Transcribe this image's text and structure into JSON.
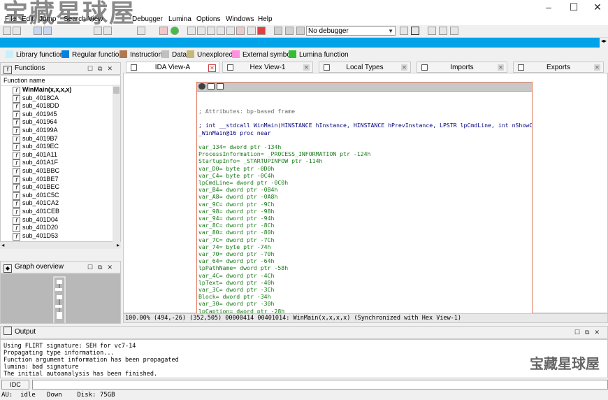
{
  "watermark": {
    "top": "宝藏星球屋",
    "bottom": "宝藏星球屋"
  },
  "menu": [
    "File",
    "Edit",
    "Jump",
    "Search",
    "View",
    "Debugger",
    "Lumina",
    "Options",
    "Windows",
    "Help"
  ],
  "toolbar": {
    "debugger_select": "No debugger"
  },
  "legend": [
    {
      "label": "Library function",
      "color": "#c8f0f8"
    },
    {
      "label": "Regular function",
      "color": "#0080e0"
    },
    {
      "label": "Instruction",
      "color": "#b07850"
    },
    {
      "label": "Data",
      "color": "#c0c0c0"
    },
    {
      "label": "Unexplored",
      "color": "#c8b878"
    },
    {
      "label": "External symbol",
      "color": "#ff90e0"
    },
    {
      "label": "Lumina function",
      "color": "#30c030"
    }
  ],
  "functions_panel": {
    "title": "Functions",
    "column_header": "Function name",
    "items": [
      "WinMain(x,x,x,x)",
      "sub_4018CA",
      "sub_4018DD",
      "sub_401945",
      "sub_401964",
      "sub_40199A",
      "sub_4019B7",
      "sub_4019EC",
      "sub_401A11",
      "sub_401A1F",
      "sub_401BBC",
      "sub_401BE7",
      "sub_401BEC",
      "sub_401C5C",
      "sub_401CA2",
      "sub_401CEB",
      "sub_401D04",
      "sub_401D20",
      "sub_401D53"
    ]
  },
  "graph_overview": {
    "title": "Graph overview"
  },
  "tabs": [
    {
      "label": "IDA View-A",
      "active": true
    },
    {
      "label": "Hex View-1"
    },
    {
      "label": "Local Types"
    },
    {
      "label": "Imports"
    },
    {
      "label": "Exports"
    }
  ],
  "ida_view": {
    "lines": [
      {
        "text": "; Attributes: bp-based frame",
        "kind": "cmt"
      },
      {
        "text": "",
        "kind": "blank"
      },
      {
        "text": "; int __stdcall WinMain(HINSTANCE hInstance, HINSTANCE hPrevInstance, LPSTR lpCmdLine, int nShowCmd)",
        "kind": "proto"
      },
      {
        "text": "_WinMain@16 proc near",
        "kind": "proto"
      },
      {
        "text": "",
        "kind": "blank"
      },
      {
        "text": "var_134= dword ptr -134h",
        "kind": "var"
      },
      {
        "text": "ProcessInformation= _PROCESS_INFORMATION ptr -124h",
        "kind": "var"
      },
      {
        "text": "StartupInfo= _STARTUPINFOW ptr -114h",
        "kind": "var"
      },
      {
        "text": "var_D0= byte ptr -0D0h",
        "kind": "var"
      },
      {
        "text": "var_C4= byte ptr -0C4h",
        "kind": "var"
      },
      {
        "text": "lpCmdLine= dword ptr -0C0h",
        "kind": "var"
      },
      {
        "text": "var_B4= dword ptr -0B4h",
        "kind": "var"
      },
      {
        "text": "var_A8= dword ptr -0A8h",
        "kind": "var"
      },
      {
        "text": "var_9C= dword ptr -9Ch",
        "kind": "var"
      },
      {
        "text": "var_98= dword ptr -98h",
        "kind": "var"
      },
      {
        "text": "var_94= dword ptr -94h",
        "kind": "var"
      },
      {
        "text": "var_8C= dword ptr -8Ch",
        "kind": "var"
      },
      {
        "text": "var_80= dword ptr -80h",
        "kind": "var"
      },
      {
        "text": "var_7C= dword ptr -7Ch",
        "kind": "var"
      },
      {
        "text": "var_74= byte ptr -74h",
        "kind": "var"
      },
      {
        "text": "var_70= dword ptr -70h",
        "kind": "var"
      },
      {
        "text": "var_64= dword ptr -64h",
        "kind": "var"
      },
      {
        "text": "lpPathName= dword ptr -58h",
        "kind": "var"
      },
      {
        "text": "var_4C= dword ptr -4Ch",
        "kind": "var"
      },
      {
        "text": "lpText= dword ptr -40h",
        "kind": "var"
      },
      {
        "text": "var_3C= dword ptr -3Ch",
        "kind": "var"
      },
      {
        "text": "Block= dword ptr -34h",
        "kind": "var"
      },
      {
        "text": "var_30= dword ptr -30h",
        "kind": "var"
      },
      {
        "text": "lpCaption= dword ptr -28h",
        "kind": "var"
      }
    ],
    "status": "100.00% (494,-26) (352,505) 00000414 00401014: WinMain(x,x,x,x) (Synchronized with Hex View-1)"
  },
  "output": {
    "title": "Output",
    "lines": [
      "Using FLIRT signature: SEH for vc7-14",
      "Propagating type information...",
      "Function argument information has been propagated",
      "lumina: bad signature",
      "The initial autoanalysis has been finished."
    ]
  },
  "command": {
    "button_label": "IDC",
    "value": ""
  },
  "statusbar": "AU:  idle   Down    Disk: 75GB"
}
